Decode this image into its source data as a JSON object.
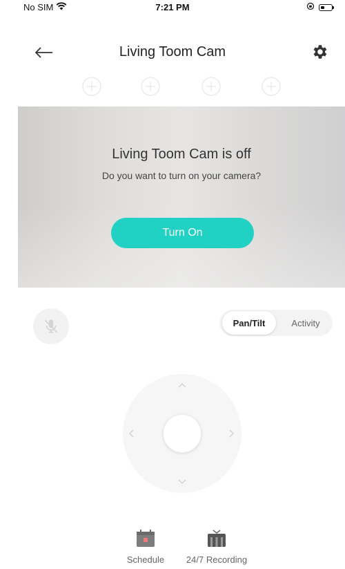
{
  "status_bar": {
    "carrier": "No SIM",
    "time": "7:21 PM"
  },
  "nav": {
    "title": "Living Toom Cam"
  },
  "camera_panel": {
    "title": "Living Toom Cam is off",
    "subtitle": "Do you want to turn on your camera?",
    "turn_on_label": "Turn On"
  },
  "mode_toggle": {
    "tabs": [
      {
        "label": "Pan/Tilt",
        "active": true
      },
      {
        "label": "Activity",
        "active": false
      }
    ]
  },
  "bottom_tabs": [
    {
      "label": "Schedule",
      "icon": "calendar-icon"
    },
    {
      "label": "24/7 Recording",
      "icon": "recording-icon"
    }
  ],
  "colors": {
    "accent": "#21d1c4",
    "icon_light": "#d8d8d8"
  }
}
